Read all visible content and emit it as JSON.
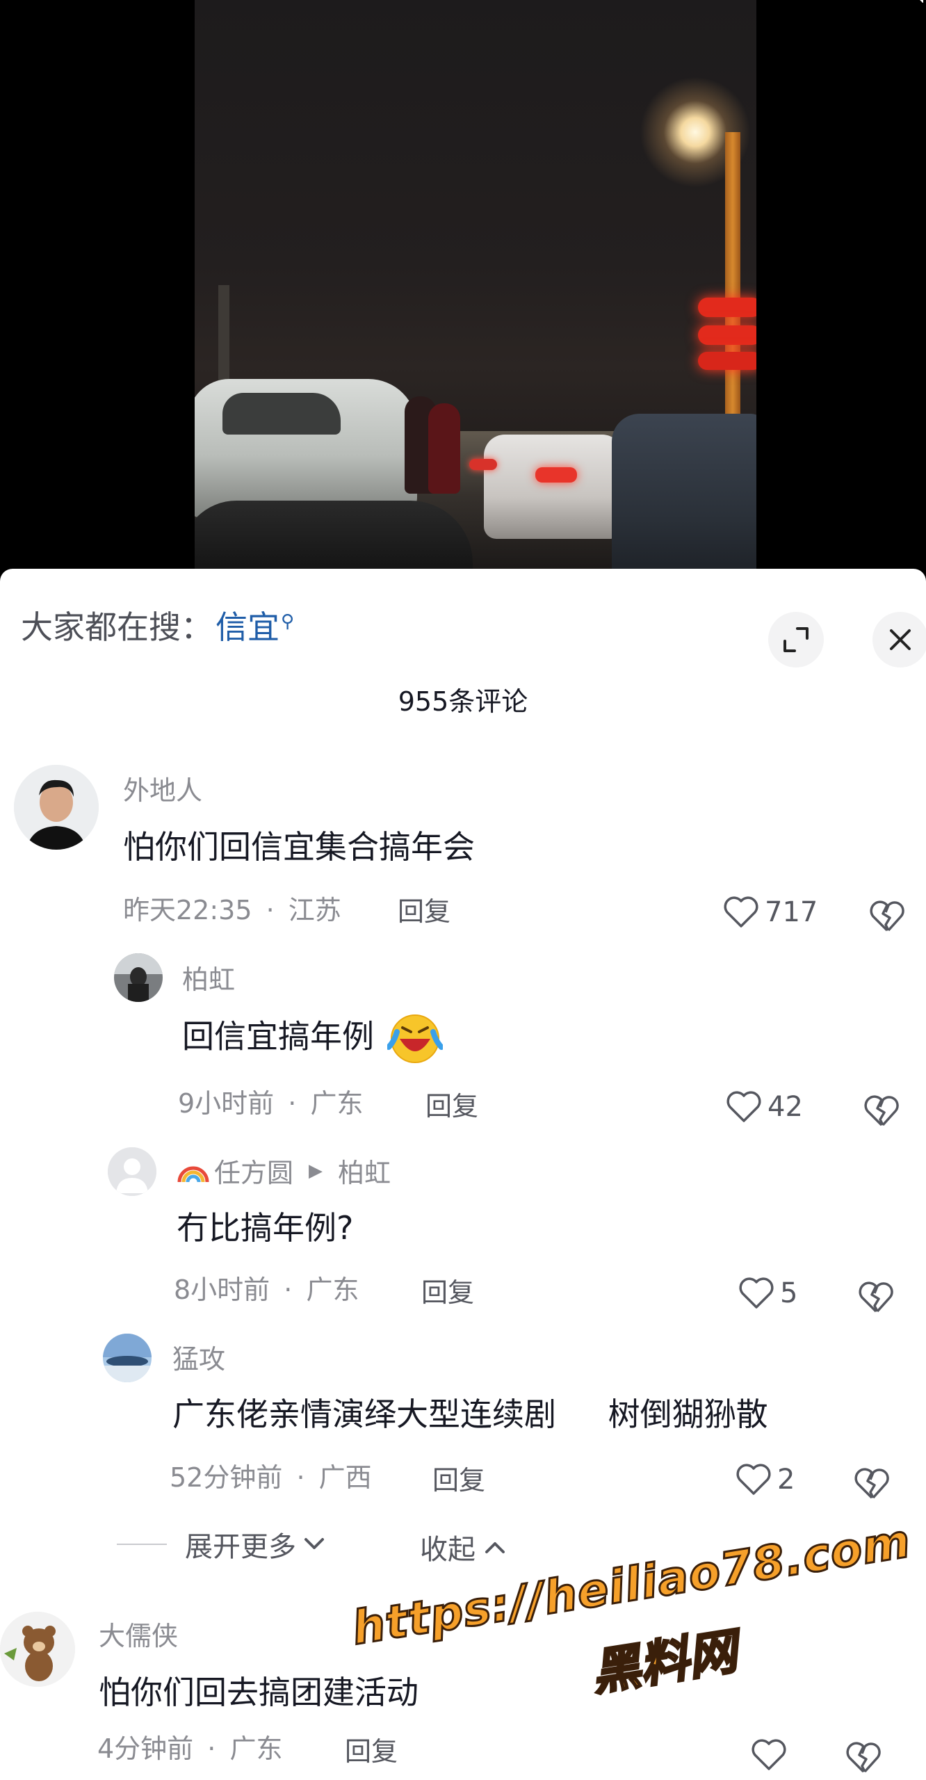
{
  "hot_search": {
    "prefix": "大家都在搜：",
    "keyword": "信宜"
  },
  "comment_count": "955条评论",
  "comments": [
    {
      "name": "外地人",
      "text": "怕你们回信宜集合搞年会",
      "time": "昨天22:35",
      "location": "江苏",
      "reply": "回复",
      "likes": "717"
    },
    {
      "name": "柏虹",
      "text": "回信宜搞年例",
      "time": "9小时前",
      "location": "广东",
      "reply": "回复",
      "likes": "42"
    },
    {
      "name": "任方圆",
      "reply_to": "柏虹",
      "text": "冇比搞年例?",
      "time": "8小时前",
      "location": "广东",
      "reply": "回复",
      "likes": "5"
    },
    {
      "name": "猛攻",
      "text": "广东佬亲情演绎大型连续剧",
      "text_extra": "树倒猢狲散",
      "time": "52分钟前",
      "location": "广西",
      "reply": "回复",
      "likes": "2"
    },
    {
      "name": "大儒侠",
      "text": "怕你们回去搞团建活动",
      "time": "4分钟前",
      "location": "广东",
      "reply": "回复",
      "likes": ""
    }
  ],
  "meta_separator": "·",
  "expand_more": "展开更多",
  "collapse": "收起",
  "watermark": {
    "url": "https://heiliao78.com",
    "name": "黑料网"
  },
  "icons": {
    "search": "search-icon",
    "expand": "expand-icon",
    "close": "close-icon",
    "like": "heart-icon",
    "dislike": "broken-heart-icon"
  },
  "colors": {
    "keyword": "#1f5da8",
    "secondary_text": "#8a8b91",
    "watermark": "#f6a02a"
  }
}
